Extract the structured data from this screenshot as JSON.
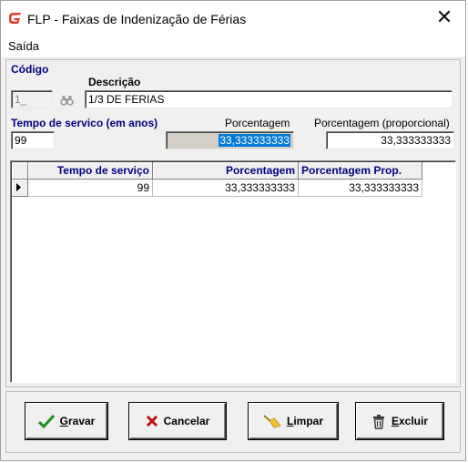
{
  "window": {
    "title": "FLP - Faixas de  Indenização de Férias",
    "close_glyph": "✕"
  },
  "menu": {
    "items": [
      "Saída"
    ]
  },
  "form": {
    "codigo_label": "Código",
    "codigo_value": "1_",
    "descricao_label": "Descrição",
    "descricao_value": "1/3 DE FERIAS",
    "tempo_label": "Tempo de servico (em anos)",
    "tempo_value": "99",
    "porcentagem_label": "Porcentagem",
    "porcentagem_value": "33,333333333",
    "porcentagem_prop_label": "Porcentagem (proporcional)",
    "porcentagem_prop_value": "33,333333333"
  },
  "grid": {
    "columns": [
      "Tempo de serviço",
      "Porcentagem",
      "Porcentagem Prop."
    ],
    "rows": [
      {
        "tempo": "99",
        "porcentagem": "33,333333333",
        "porcentagem_prop": "33,333333333"
      }
    ]
  },
  "buttons": {
    "gravar": {
      "key": "G",
      "rest": "ravar",
      "icon": "checkmark-icon"
    },
    "cancelar": {
      "label": "Cancelar",
      "icon": "x-icon"
    },
    "limpar": {
      "key": "L",
      "rest": "impar",
      "icon": "broom-icon"
    },
    "excluir": {
      "key": "E",
      "rest": "xcluir",
      "icon": "trash-icon"
    }
  },
  "colors": {
    "label_blue": "#000080",
    "selection": "#0078d7",
    "logo_red": "#e03c31",
    "check_green": "#1a8f1a",
    "cancel_red": "#c01010"
  }
}
